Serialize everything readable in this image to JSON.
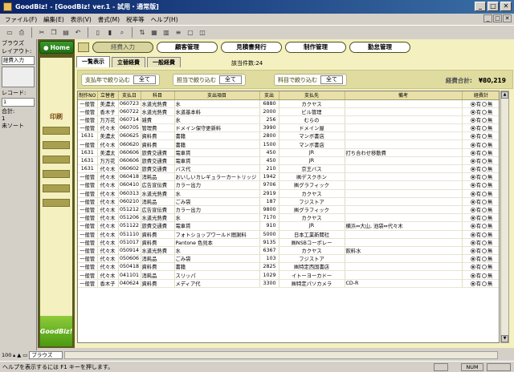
{
  "window": {
    "title": "GoodBiz! - [GoodBiz! ver.1 - 試用・通常版]",
    "min": "_",
    "max": "□",
    "close": "✕"
  },
  "menu": [
    "ファイル(F)",
    "編集(E)",
    "表示(V)",
    "書式(M)",
    "税率等",
    "ヘルプ(H)"
  ],
  "status_area": {
    "browse_label": "ブラウズ",
    "layout_label": "レイアウト:",
    "layout_value": "経費入力",
    "record_label": "レコード:",
    "record_value": "1",
    "total_label": "合計:",
    "total_value": "1",
    "sort_label": "未ソート"
  },
  "left_panel": {
    "home": "Home",
    "print": "印刷",
    "logo": "GoodBiz!"
  },
  "nav": [
    "経費入力",
    "顧客管理",
    "見積書発行",
    "制作管理",
    "勤怠管理"
  ],
  "subtabs": [
    "一覧表示",
    "立替経費",
    "一般経費"
  ],
  "count_text": "該当件数:24",
  "filters": [
    {
      "label": "支払年で絞り込む",
      "value": "全て"
    },
    {
      "label": "担当で絞り込む",
      "value": "全て"
    },
    {
      "label": "科目で絞り込む",
      "value": "全て"
    }
  ],
  "total": {
    "label": "経費合計:",
    "value": "¥80,219"
  },
  "table": {
    "headers": [
      "制作NO",
      "立替者",
      "支払日",
      "科目",
      "支出項目",
      "支出",
      "支払先",
      "備考",
      "経費計"
    ],
    "paid_labels": [
      "有",
      "無"
    ],
    "rows": [
      [
        "一般管",
        "美濃太",
        "060723",
        "水道光熱費",
        "水",
        "6880",
        "カクヤス",
        "",
        "有"
      ],
      [
        "一般管",
        "香木子",
        "060722",
        "水道光熱費",
        "水道基本料",
        "2000",
        "ビル管理",
        "",
        "有"
      ],
      [
        "一般管",
        "万万花",
        "060714",
        "雑費",
        "氷",
        "256",
        "むらの",
        "",
        "有"
      ],
      [
        "一般管",
        "代々木",
        "060705",
        "管理費",
        "ドメイン保守更新料",
        "3990",
        "ドメイン屋",
        "",
        "有"
      ],
      [
        "1631",
        "美濃太",
        "060625",
        "資料費",
        "書籍",
        "2800",
        "マンボ書店",
        "",
        "有"
      ],
      [
        "一般管",
        "代々木",
        "060620",
        "資料費",
        "書籍",
        "1500",
        "マンボ書店",
        "",
        "有"
      ],
      [
        "1631",
        "美濃太",
        "060606",
        "旅費交通費",
        "電車賃",
        "450",
        "JR",
        "打ち合わせ移動費",
        "有"
      ],
      [
        "1631",
        "万万花",
        "060606",
        "旅費交通費",
        "電車賃",
        "450",
        "JR",
        "",
        "有"
      ],
      [
        "1631",
        "代々木",
        "060602",
        "旅費交通費",
        "バス代",
        "210",
        "京王バス",
        "",
        "有"
      ],
      [
        "一般管",
        "代々木",
        "060418",
        "消耗品",
        "おいしいカレギュラーカートリッジ",
        "1942",
        "㈱デスクホン",
        "",
        "有"
      ],
      [
        "一般管",
        "代々木",
        "060410",
        "広告宣伝費",
        "カラー出力",
        "9706",
        "㈱グラフィック",
        "",
        "有"
      ],
      [
        "一般管",
        "代々木",
        "060313",
        "水道光熱費",
        "水",
        "2919",
        "カクヤス",
        "",
        "有"
      ],
      [
        "一般管",
        "代々木",
        "060210",
        "消耗品",
        "ごみ袋",
        "187",
        "フジストア",
        "",
        "有"
      ],
      [
        "一般管",
        "代々木",
        "051212",
        "広告宣伝費",
        "カラー出力",
        "9800",
        "㈱グラフィック",
        "",
        "有"
      ],
      [
        "一般管",
        "代々木",
        "051206",
        "水道光熱費",
        "水",
        "7170",
        "カクヤス",
        "",
        "有"
      ],
      [
        "一般管",
        "代々木",
        "051122",
        "旅費交通費",
        "電車賃",
        "910",
        "JR",
        "横浜⇔大山, 池袋⇔代々木",
        "有"
      ],
      [
        "一般管",
        "代々木",
        "051110",
        "資料費",
        "フォトショップワールド間謝料",
        "5000",
        "日本工業新聞社",
        "",
        "有"
      ],
      [
        "一般管",
        "代々木",
        "051017",
        "資料費",
        "Pantone 色見本",
        "9135",
        "㈱NSBコーポレー",
        "",
        "有"
      ],
      [
        "一般管",
        "代々木",
        "050914",
        "水道光熱費",
        "水",
        "6367",
        "カクヤス",
        "飲料水",
        "有"
      ],
      [
        "一般管",
        "代々木",
        "050606",
        "消耗品",
        "ごみ袋",
        "103",
        "フジストア",
        "",
        "有"
      ],
      [
        "一般管",
        "代々木",
        "050418",
        "資料費",
        "書籍",
        "2825",
        "㈱特定西国書店",
        "",
        "有"
      ],
      [
        "一般管",
        "代々木",
        "041101",
        "消耗品",
        "スリッパ",
        "1029",
        "イトーヨーカドー",
        "",
        "有"
      ],
      [
        "一般管",
        "香木子",
        "040624",
        "資料費",
        "メディア代",
        "3300",
        "㈱特定パソカメラ",
        "CD-R",
        "有"
      ]
    ]
  },
  "bottom": {
    "zoom": "100",
    "mode": "ブラウズ"
  },
  "statusbar": {
    "text": "ヘルプを表示するには F1 キーを押します。",
    "num": "NUM"
  }
}
